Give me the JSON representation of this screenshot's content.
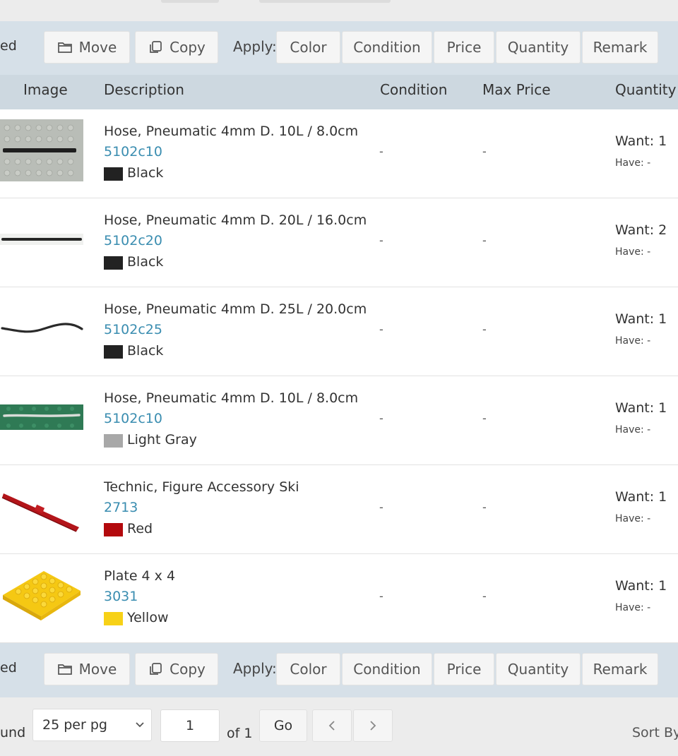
{
  "toolbar": {
    "cut_label": "ed",
    "move_label": "Move",
    "copy_label": "Copy",
    "apply_label": "Apply:",
    "apply_buttons": [
      "Color",
      "Condition",
      "Price",
      "Quantity",
      "Remark"
    ]
  },
  "table": {
    "headers": {
      "image": "Image",
      "description": "Description",
      "condition": "Condition",
      "max_price": "Max Price",
      "quantity": "Quantity"
    },
    "rows": [
      {
        "description": "Hose, Pneumatic 4mm D. 10L / 8.0cm",
        "item_no": "5102c10",
        "color": "Black",
        "swatch": "#222222",
        "condition": "-",
        "max_price": "-",
        "want": "Want: 1",
        "have": "Have: -",
        "image": "black-hose-short"
      },
      {
        "description": "Hose, Pneumatic 4mm D. 20L / 16.0cm",
        "item_no": "5102c20",
        "color": "Black",
        "swatch": "#222222",
        "condition": "-",
        "max_price": "-",
        "want": "Want: 2",
        "have": "Have: -",
        "image": "black-hose-long"
      },
      {
        "description": "Hose, Pneumatic 4mm D. 25L / 20.0cm",
        "item_no": "5102c25",
        "color": "Black",
        "swatch": "#222222",
        "condition": "-",
        "max_price": "-",
        "want": "Want: 1",
        "have": "Have: -",
        "image": "black-hose-wavy"
      },
      {
        "description": "Hose, Pneumatic 4mm D. 10L / 8.0cm",
        "item_no": "5102c10",
        "color": "Light Gray",
        "swatch": "#a8a8a8",
        "condition": "-",
        "max_price": "-",
        "want": "Want: 1",
        "have": "Have: -",
        "image": "gray-hose-on-green"
      },
      {
        "description": "Technic, Figure Accessory Ski",
        "item_no": "2713",
        "color": "Red",
        "swatch": "#b3090d",
        "condition": "-",
        "max_price": "-",
        "want": "Want: 1",
        "have": "Have: -",
        "image": "red-ski"
      },
      {
        "description": "Plate 4 x 4",
        "item_no": "3031",
        "color": "Yellow",
        "swatch": "#f7d117",
        "condition": "-",
        "max_price": "-",
        "want": "Want: 1",
        "have": "Have: -",
        "image": "yellow-plate"
      }
    ]
  },
  "pager": {
    "found_label": "und",
    "per_page": "25 per pg",
    "page": "1",
    "of_label": "of 1",
    "go_label": "Go",
    "sort_label": "Sort By"
  },
  "colors": {
    "link": "#3a8db0",
    "toolbar_bg": "#d6e0e8",
    "header_bg": "#cdd8e0"
  }
}
